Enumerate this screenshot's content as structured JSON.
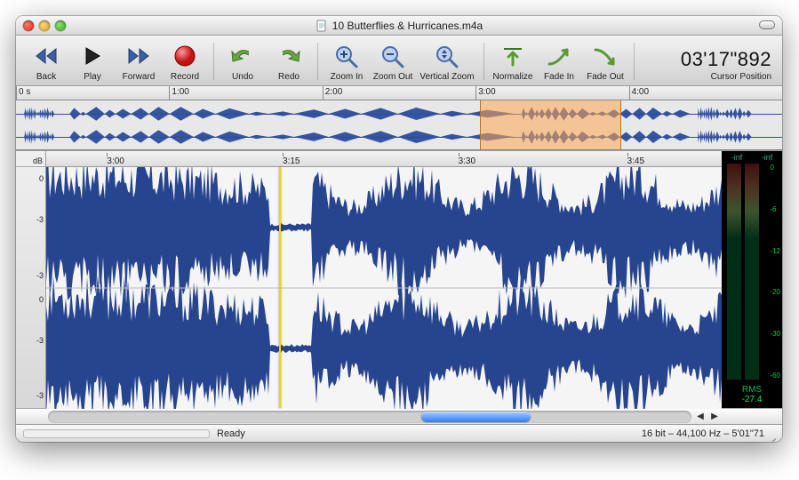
{
  "window": {
    "title": "10 Butterflies & Hurricanes.m4a"
  },
  "toolbar": {
    "back": "Back",
    "play": "Play",
    "forward": "Forward",
    "record": "Record",
    "undo": "Undo",
    "redo": "Redo",
    "zoom_in": "Zoom In",
    "zoom_out": "Zoom Out",
    "vertical_zoom": "Vertical Zoom",
    "normalize": "Normalize",
    "fade_in": "Fade In",
    "fade_out": "Fade Out",
    "cursor_position_label": "Cursor Position",
    "cursor_position_value": "03'17\"892"
  },
  "overview_ruler": {
    "ticks": [
      "0 s",
      "1:00",
      "2:00",
      "3:00",
      "4:00"
    ],
    "positions_pct": [
      0,
      20,
      40,
      60,
      80
    ]
  },
  "overview": {
    "selection_start_pct": 60.5,
    "selection_end_pct": 79
  },
  "detail_ruler": {
    "ticks": [
      "3:00",
      "3:15",
      "3:30",
      "3:45"
    ],
    "positions_pct": [
      9,
      35,
      61,
      86
    ]
  },
  "db_gutter": {
    "header": "dB",
    "marks": [
      "0",
      "-3",
      "-3",
      "0",
      "-3",
      "-3"
    ]
  },
  "playhead_pct": 34.5,
  "scrollbar": {
    "thumb_left_pct": 58,
    "thumb_width_pct": 17
  },
  "meter": {
    "top_labels": [
      "-inf",
      "-inf"
    ],
    "scale": [
      "0",
      "-6",
      "-12",
      "-20",
      "-30",
      "-60"
    ],
    "rms_label": "RMS",
    "rms_value": "-27.4"
  },
  "status": {
    "message": "Ready",
    "info": "16 bit – 44,100 Hz – 5'01\"71"
  }
}
